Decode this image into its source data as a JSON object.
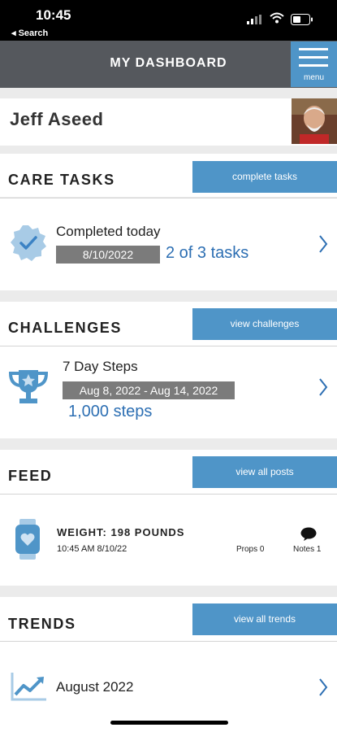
{
  "status_bar": {
    "time": "10:45",
    "back_label": "◂ Search"
  },
  "header": {
    "title": "MY DASHBOARD",
    "menu_label": "menu"
  },
  "user": {
    "name": "Jeff Aseed"
  },
  "care_tasks": {
    "title": "CARE TASKS",
    "button": "complete tasks",
    "label": "Completed today",
    "date": "8/10/2022",
    "summary": "2 of 3 tasks"
  },
  "challenges": {
    "title": "CHALLENGES",
    "button": "view challenges",
    "name": "7 Day Steps",
    "date_range": "Aug 8, 2022 - Aug 14, 2022",
    "steps": "1,000 steps"
  },
  "feed": {
    "title": "FEED",
    "button": "view all posts",
    "post_title": "WEIGHT: 198 POUNDS",
    "post_time": "10:45 AM 8/10/22",
    "props": "Props 0",
    "notes": "Notes 1"
  },
  "trends": {
    "title": "TRENDS",
    "button": "view all trends",
    "period": "August 2022"
  },
  "colors": {
    "accent": "#4f95c8",
    "header": "#55585d",
    "link": "#2d6fb3",
    "date_box": "#7b7b7b",
    "icon": "#4f95c8"
  }
}
